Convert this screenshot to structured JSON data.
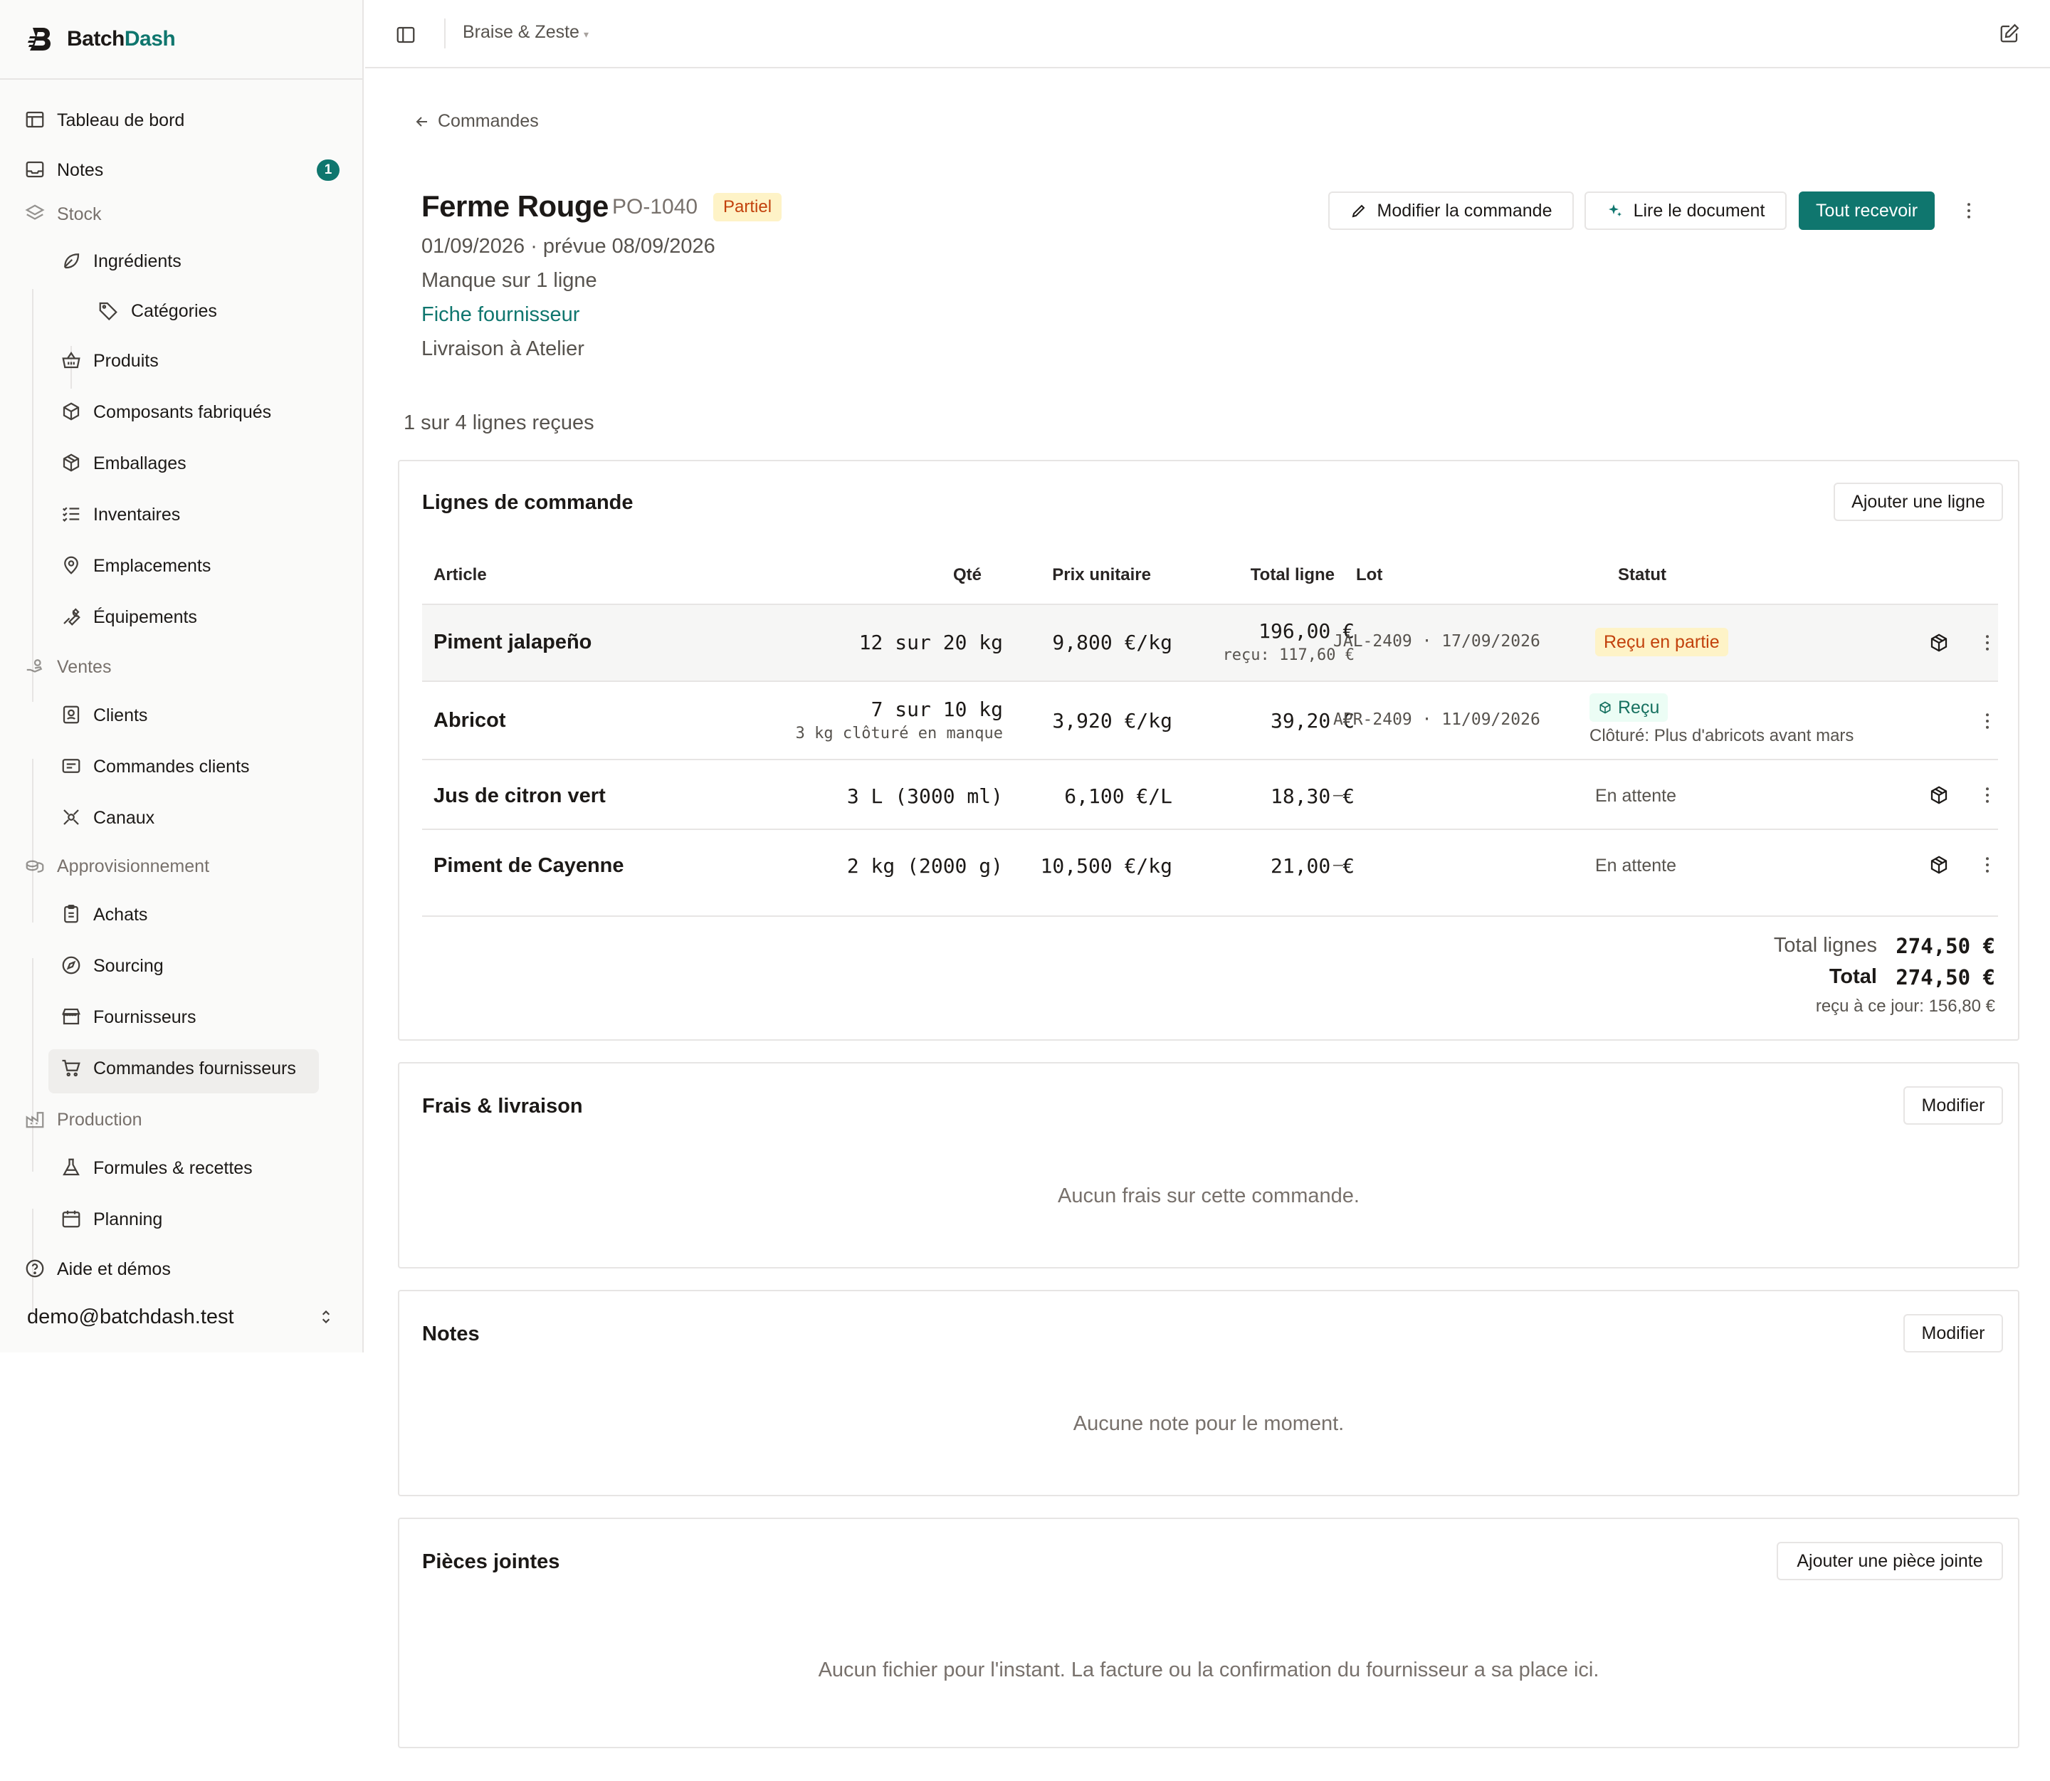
{
  "brand": {
    "name_part1": "Batch",
    "name_part2": "Dash",
    "accent": "#0f766e"
  },
  "sidebar": {
    "dashboard": "Tableau de bord",
    "notes": "Notes",
    "notes_count": "1",
    "stock": "Stock",
    "ingredients": "Ingrédients",
    "categories": "Catégories",
    "products": "Produits",
    "components": "Composants fabriqués",
    "packaging": "Emballages",
    "inventories": "Inventaires",
    "locations": "Emplacements",
    "equipment": "Équipements",
    "sales": "Ventes",
    "clients": "Clients",
    "client_orders": "Commandes clients",
    "channels": "Canaux",
    "procurement": "Approvisionnement",
    "purchases": "Achats",
    "sourcing": "Sourcing",
    "suppliers": "Fournisseurs",
    "supplier_orders": "Commandes fournisseurs",
    "production": "Production",
    "recipes": "Formules & recettes",
    "planning": "Planning",
    "help": "Aide et démos",
    "user_email": "demo@batchdash.test"
  },
  "topbar": {
    "workspace": "Braise & Zeste",
    "workspace_caret": "▾"
  },
  "order": {
    "back_label": "Commandes",
    "supplier": "Ferme Rouge",
    "number": "PO-1040",
    "status": "Partiel",
    "dates": "01/09/2026 · prévue 08/09/2026",
    "missing": "Manque sur 1 ligne",
    "supplier_link": "Fiche fournisseur",
    "delivery": "Livraison à Atelier",
    "progress": "1 sur 4 lignes reçues"
  },
  "actions": {
    "edit": "Modifier la commande",
    "read_doc": "Lire le document",
    "receive_all": "Tout recevoir"
  },
  "lines": {
    "title": "Lignes de commande",
    "add_button": "Ajouter une ligne",
    "headers": {
      "article": "Article",
      "qty": "Qté",
      "unit_price": "Prix unitaire",
      "line_total": "Total ligne",
      "lot": "Lot",
      "status": "Statut"
    },
    "rows": [
      {
        "article": "Piment jalapeño",
        "qty": "12 sur 20 kg",
        "unit_price": "9,800 €/kg",
        "line_total": "196,00 €",
        "received": "reçu: 117,60 €",
        "lot": "JAL-2409 · 17/09/2026",
        "status": "Reçu en partie"
      },
      {
        "article": "Abricot",
        "qty": "7 sur 10 kg",
        "qty_note": "3 kg clôturé en manque",
        "unit_price": "3,920 €/kg",
        "line_total": "39,20 €",
        "lot": "APR-2409 · 11/09/2026",
        "status": "Reçu",
        "status_note": "Clôturé: Plus d'abricots avant mars"
      },
      {
        "article": "Jus de citron vert",
        "qty": "3 L (3000 ml)",
        "unit_price": "6,100 €/L",
        "line_total": "18,30 €",
        "lot": "—",
        "status": "En attente"
      },
      {
        "article": "Piment de Cayenne",
        "qty": "2 kg (2000 g)",
        "unit_price": "10,500 €/kg",
        "line_total": "21,00 €",
        "lot": "—",
        "status": "En attente"
      }
    ],
    "totals": {
      "lines_label": "Total lignes",
      "lines_value": "274,50 €",
      "total_label": "Total",
      "total_value": "274,50 €",
      "received_to_date": "reçu à ce jour: 156,80 €"
    }
  },
  "fees": {
    "title": "Frais & livraison",
    "edit": "Modifier",
    "empty": "Aucun frais sur cette commande."
  },
  "notes": {
    "title": "Notes",
    "edit": "Modifier",
    "empty": "Aucune note pour le moment."
  },
  "attachments": {
    "title": "Pièces jointes",
    "add": "Ajouter une pièce jointe",
    "empty": "Aucun fichier pour l'instant. La facture ou la confirmation du fournisseur a sa place ici."
  }
}
